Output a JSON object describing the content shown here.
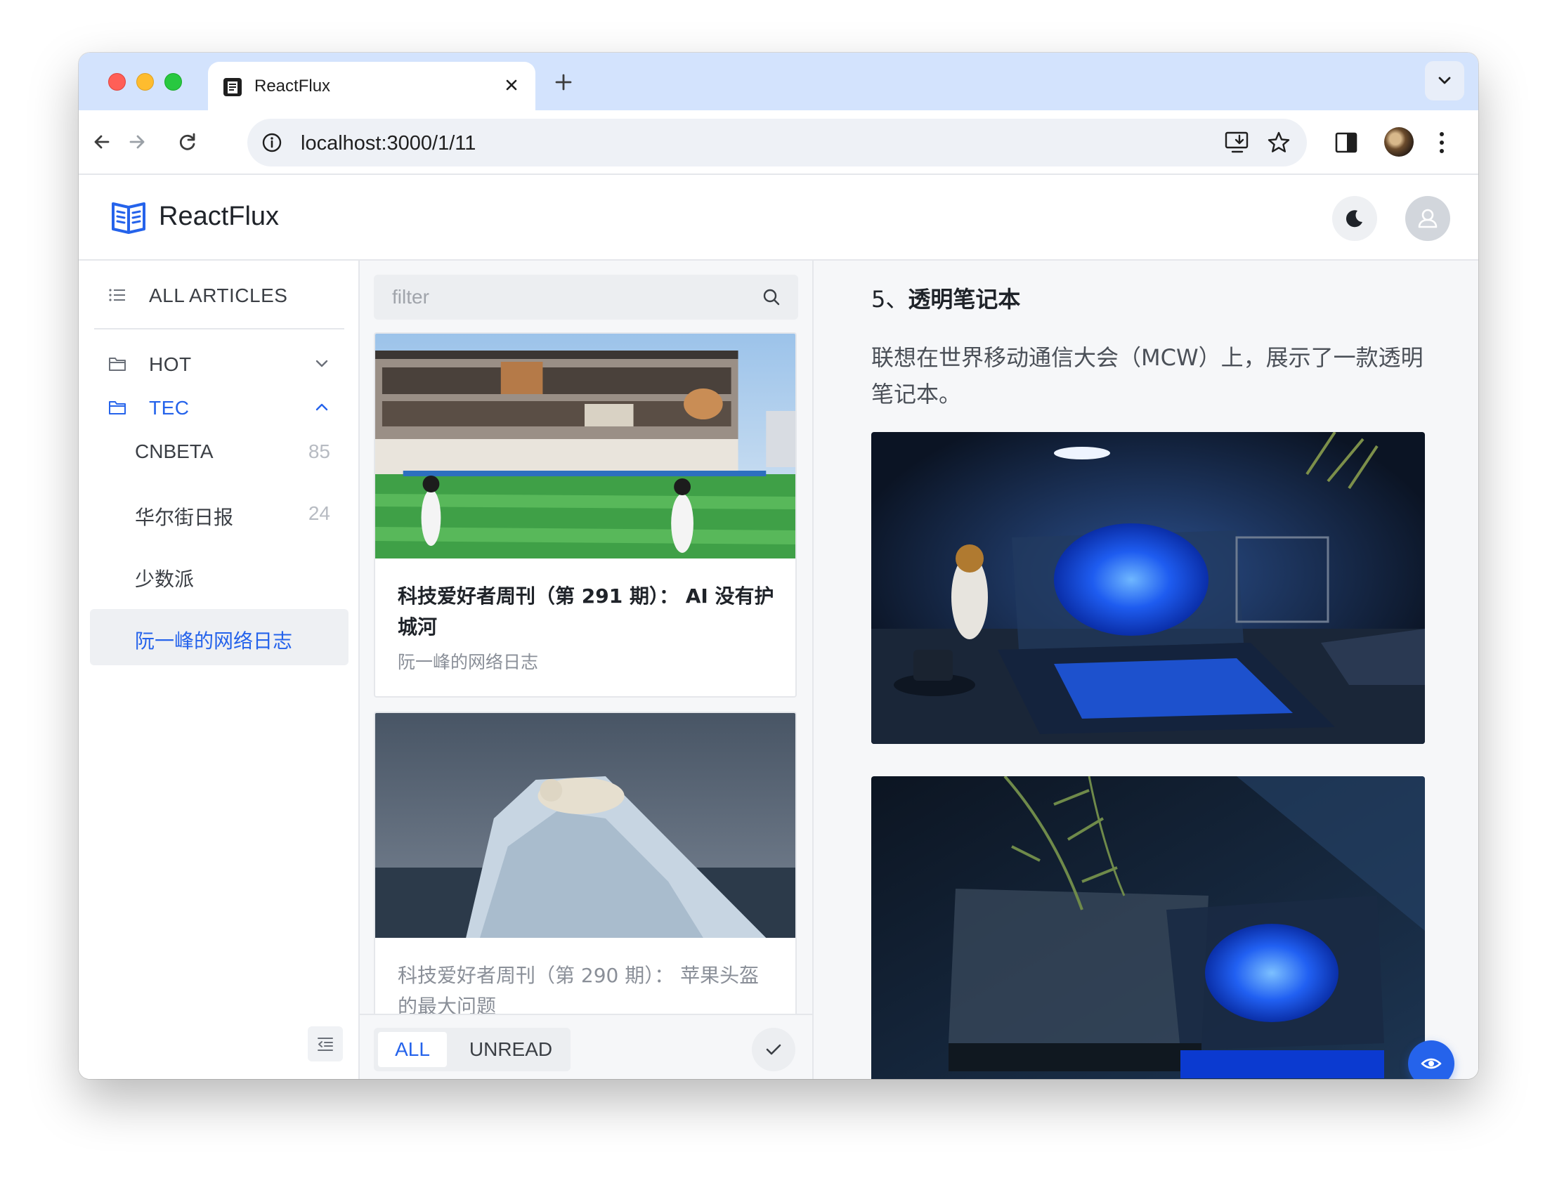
{
  "browser": {
    "tab_title": "ReactFlux",
    "url": "localhost:3000/1/11"
  },
  "app": {
    "title": "ReactFlux"
  },
  "sidebar": {
    "all_articles": "ALL ARTICLES",
    "categories": [
      {
        "label": "HOT",
        "expanded": false
      },
      {
        "label": "TEC",
        "expanded": true
      }
    ],
    "feeds": [
      {
        "label": "CNBETA",
        "count": "85"
      },
      {
        "label": "华尔街日报",
        "count": "24"
      },
      {
        "label": "少数派",
        "count": ""
      },
      {
        "label": "阮一峰的网络日志",
        "count": "",
        "active": true
      }
    ]
  },
  "list": {
    "filter_placeholder": "filter",
    "articles": [
      {
        "title": "科技爱好者周刊（第 291 期）： AI 没有护城河",
        "source": "阮一峰的网络日志",
        "read": false
      },
      {
        "title": "科技爱好者周刊（第 290 期）： 苹果头盔的最大问题",
        "source": "",
        "read": true
      }
    ],
    "filter_tabs": {
      "all": "ALL",
      "unread": "UNREAD"
    }
  },
  "content": {
    "heading_prefix": "5、",
    "heading": "透明笔记本",
    "paragraph": "联想在世界移动通信大会（MCW）上，展示了一款透明笔记本。"
  },
  "colors": {
    "accent": "#2563eb",
    "tab_bar": "#d3e3fd"
  }
}
